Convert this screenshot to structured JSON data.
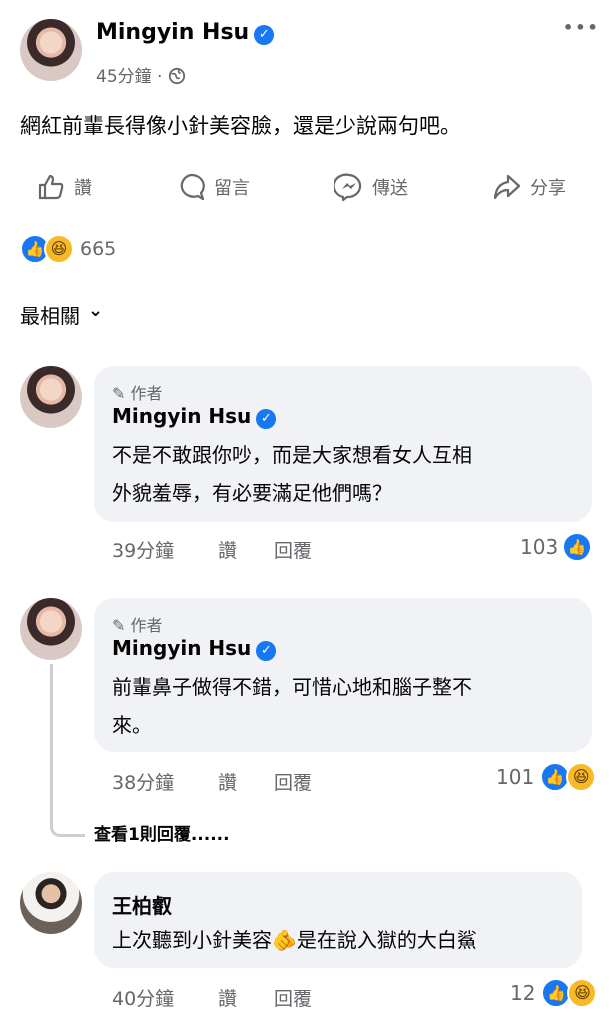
{
  "post": {
    "author": "Mingyin Hsu",
    "time": "45分鐘",
    "separator": "·",
    "text": "網紅前輩長得像小針美容臉，還是少說兩句吧。",
    "reaction_count": "665",
    "more_menu": "•••"
  },
  "actions": {
    "like": "讚",
    "comment": "留言",
    "send": "傳送",
    "share": "分享"
  },
  "sort": {
    "label": "最相關",
    "chevron": "⌄"
  },
  "comments": [
    {
      "author_tag": "作者",
      "name": "Mingyin Hsu",
      "text_lines": [
        "不是不敢跟你吵，而是大家想看女人互相",
        "外貌羞辱，有必要滿足他們嗎？"
      ],
      "time": "39分鐘",
      "like": "讚",
      "reply": "回覆",
      "count": "103"
    },
    {
      "author_tag": "作者",
      "name": "Mingyin Hsu",
      "text_lines": [
        "前輩鼻子做得不錯，可惜心地和腦子整不",
        "來。"
      ],
      "time": "38分鐘",
      "like": "讚",
      "reply": "回覆",
      "count": "101",
      "view_replies": "查看1則回覆......"
    },
    {
      "name": "王柏叡",
      "text_before_emoji": "上次聽到小針美容",
      "emoji": "🫵",
      "text_after_emoji": "是在說入獄的大白鯊",
      "time": "40分鐘",
      "like": "讚",
      "reply": "回覆",
      "count": "12"
    }
  ],
  "colors": {
    "accent": "#1877f2",
    "haha": "#f7b928",
    "muted": "#65676b",
    "bubble": "#f0f2f5"
  }
}
